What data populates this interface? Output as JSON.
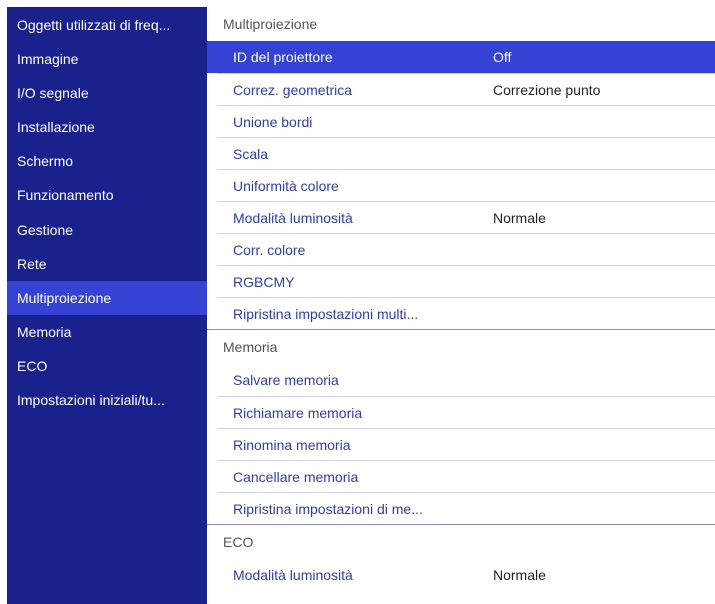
{
  "sidebar": {
    "items": [
      {
        "label": "Oggetti utilizzati di freq...",
        "selected": false
      },
      {
        "label": "Immagine",
        "selected": false
      },
      {
        "label": "I/O segnale",
        "selected": false
      },
      {
        "label": "Installazione",
        "selected": false
      },
      {
        "label": "Schermo",
        "selected": false
      },
      {
        "label": "Funzionamento",
        "selected": false
      },
      {
        "label": "Gestione",
        "selected": false
      },
      {
        "label": "Rete",
        "selected": false
      },
      {
        "label": "Multiproiezione",
        "selected": true
      },
      {
        "label": "Memoria",
        "selected": false
      },
      {
        "label": "ECO",
        "selected": false
      },
      {
        "label": "Impostazioni iniziali/tu...",
        "selected": false
      }
    ]
  },
  "sections": [
    {
      "title": "Multiproiezione",
      "rows": [
        {
          "label": "ID del proiettore",
          "value": "Off",
          "selected": true
        },
        {
          "label": "Correz. geometrica",
          "value": "Correzione punto"
        },
        {
          "label": "Unione bordi",
          "value": ""
        },
        {
          "label": "Scala",
          "value": ""
        },
        {
          "label": "Uniformità colore",
          "value": ""
        },
        {
          "label": "Modalità luminosità",
          "value": "Normale"
        },
        {
          "label": "Corr. colore",
          "value": ""
        },
        {
          "label": "RGBCMY",
          "value": ""
        },
        {
          "label": "Ripristina impostazioni multi...",
          "value": ""
        }
      ]
    },
    {
      "title": "Memoria",
      "rows": [
        {
          "label": "Salvare memoria",
          "value": ""
        },
        {
          "label": "Richiamare memoria",
          "value": ""
        },
        {
          "label": "Rinomina memoria",
          "value": ""
        },
        {
          "label": "Cancellare memoria",
          "value": ""
        },
        {
          "label": "Ripristina impostazioni di me...",
          "value": ""
        }
      ]
    },
    {
      "title": "ECO",
      "rows": [
        {
          "label": "Modalità luminosità",
          "value": "Normale"
        }
      ]
    }
  ],
  "colors": {
    "sidebar_bg": "#19218d",
    "selected_bg": "#3443d4",
    "item_text": "#2e3fa6"
  }
}
